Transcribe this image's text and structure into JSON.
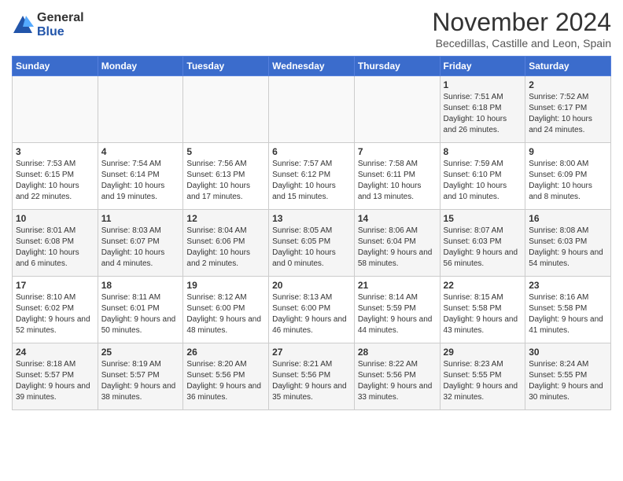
{
  "header": {
    "logo_general": "General",
    "logo_blue": "Blue",
    "month_title": "November 2024",
    "location": "Becedillas, Castille and Leon, Spain"
  },
  "days_of_week": [
    "Sunday",
    "Monday",
    "Tuesday",
    "Wednesday",
    "Thursday",
    "Friday",
    "Saturday"
  ],
  "weeks": [
    [
      {
        "day": "",
        "info": ""
      },
      {
        "day": "",
        "info": ""
      },
      {
        "day": "",
        "info": ""
      },
      {
        "day": "",
        "info": ""
      },
      {
        "day": "",
        "info": ""
      },
      {
        "day": "1",
        "info": "Sunrise: 7:51 AM\nSunset: 6:18 PM\nDaylight: 10 hours and 26 minutes."
      },
      {
        "day": "2",
        "info": "Sunrise: 7:52 AM\nSunset: 6:17 PM\nDaylight: 10 hours and 24 minutes."
      }
    ],
    [
      {
        "day": "3",
        "info": "Sunrise: 7:53 AM\nSunset: 6:15 PM\nDaylight: 10 hours and 22 minutes."
      },
      {
        "day": "4",
        "info": "Sunrise: 7:54 AM\nSunset: 6:14 PM\nDaylight: 10 hours and 19 minutes."
      },
      {
        "day": "5",
        "info": "Sunrise: 7:56 AM\nSunset: 6:13 PM\nDaylight: 10 hours and 17 minutes."
      },
      {
        "day": "6",
        "info": "Sunrise: 7:57 AM\nSunset: 6:12 PM\nDaylight: 10 hours and 15 minutes."
      },
      {
        "day": "7",
        "info": "Sunrise: 7:58 AM\nSunset: 6:11 PM\nDaylight: 10 hours and 13 minutes."
      },
      {
        "day": "8",
        "info": "Sunrise: 7:59 AM\nSunset: 6:10 PM\nDaylight: 10 hours and 10 minutes."
      },
      {
        "day": "9",
        "info": "Sunrise: 8:00 AM\nSunset: 6:09 PM\nDaylight: 10 hours and 8 minutes."
      }
    ],
    [
      {
        "day": "10",
        "info": "Sunrise: 8:01 AM\nSunset: 6:08 PM\nDaylight: 10 hours and 6 minutes."
      },
      {
        "day": "11",
        "info": "Sunrise: 8:03 AM\nSunset: 6:07 PM\nDaylight: 10 hours and 4 minutes."
      },
      {
        "day": "12",
        "info": "Sunrise: 8:04 AM\nSunset: 6:06 PM\nDaylight: 10 hours and 2 minutes."
      },
      {
        "day": "13",
        "info": "Sunrise: 8:05 AM\nSunset: 6:05 PM\nDaylight: 10 hours and 0 minutes."
      },
      {
        "day": "14",
        "info": "Sunrise: 8:06 AM\nSunset: 6:04 PM\nDaylight: 9 hours and 58 minutes."
      },
      {
        "day": "15",
        "info": "Sunrise: 8:07 AM\nSunset: 6:03 PM\nDaylight: 9 hours and 56 minutes."
      },
      {
        "day": "16",
        "info": "Sunrise: 8:08 AM\nSunset: 6:03 PM\nDaylight: 9 hours and 54 minutes."
      }
    ],
    [
      {
        "day": "17",
        "info": "Sunrise: 8:10 AM\nSunset: 6:02 PM\nDaylight: 9 hours and 52 minutes."
      },
      {
        "day": "18",
        "info": "Sunrise: 8:11 AM\nSunset: 6:01 PM\nDaylight: 9 hours and 50 minutes."
      },
      {
        "day": "19",
        "info": "Sunrise: 8:12 AM\nSunset: 6:00 PM\nDaylight: 9 hours and 48 minutes."
      },
      {
        "day": "20",
        "info": "Sunrise: 8:13 AM\nSunset: 6:00 PM\nDaylight: 9 hours and 46 minutes."
      },
      {
        "day": "21",
        "info": "Sunrise: 8:14 AM\nSunset: 5:59 PM\nDaylight: 9 hours and 44 minutes."
      },
      {
        "day": "22",
        "info": "Sunrise: 8:15 AM\nSunset: 5:58 PM\nDaylight: 9 hours and 43 minutes."
      },
      {
        "day": "23",
        "info": "Sunrise: 8:16 AM\nSunset: 5:58 PM\nDaylight: 9 hours and 41 minutes."
      }
    ],
    [
      {
        "day": "24",
        "info": "Sunrise: 8:18 AM\nSunset: 5:57 PM\nDaylight: 9 hours and 39 minutes."
      },
      {
        "day": "25",
        "info": "Sunrise: 8:19 AM\nSunset: 5:57 PM\nDaylight: 9 hours and 38 minutes."
      },
      {
        "day": "26",
        "info": "Sunrise: 8:20 AM\nSunset: 5:56 PM\nDaylight: 9 hours and 36 minutes."
      },
      {
        "day": "27",
        "info": "Sunrise: 8:21 AM\nSunset: 5:56 PM\nDaylight: 9 hours and 35 minutes."
      },
      {
        "day": "28",
        "info": "Sunrise: 8:22 AM\nSunset: 5:56 PM\nDaylight: 9 hours and 33 minutes."
      },
      {
        "day": "29",
        "info": "Sunrise: 8:23 AM\nSunset: 5:55 PM\nDaylight: 9 hours and 32 minutes."
      },
      {
        "day": "30",
        "info": "Sunrise: 8:24 AM\nSunset: 5:55 PM\nDaylight: 9 hours and 30 minutes."
      }
    ]
  ]
}
